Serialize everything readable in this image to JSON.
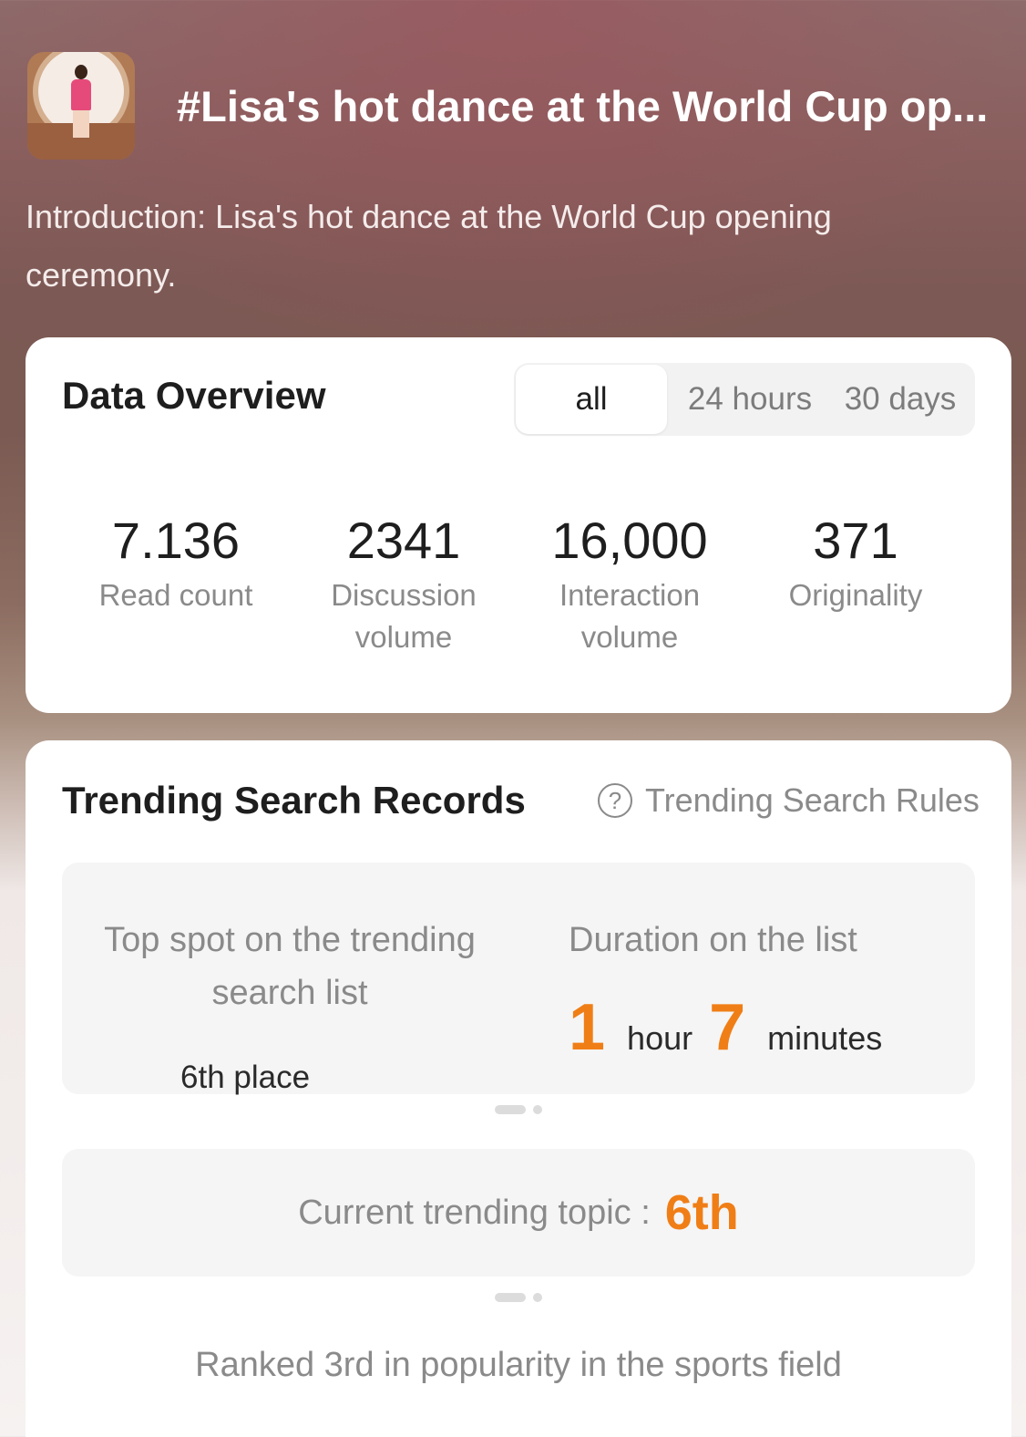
{
  "topic": {
    "title": "#Lisa's hot dance at the World Cup op...",
    "introduction": "Introduction: Lisa's hot dance at the World Cup opening ceremony."
  },
  "overview": {
    "title": "Data Overview",
    "tabs": [
      "all",
      "24 hours",
      "30 days"
    ],
    "active_tab": "all",
    "stats": [
      {
        "value": "7.136",
        "label": "Read count"
      },
      {
        "value": "2341",
        "label": "Discussion volume"
      },
      {
        "value": "16,000",
        "label": "Interaction volume"
      },
      {
        "value": "371",
        "label": "Originality"
      }
    ]
  },
  "trending": {
    "title": "Trending Search Records",
    "rules_label": "Trending Search Rules",
    "top_spot_label": "Top spot on the trending search list",
    "top_spot_value": "6th place",
    "duration_label": "Duration on the list",
    "duration_hours": "1",
    "hour_unit": "hour",
    "duration_minutes": "7",
    "minute_unit": "minutes",
    "current_label": "Current trending topic :",
    "current_value": "6th",
    "rank_text": "Ranked 3rd in popularity in the sports field"
  },
  "colors": {
    "accent": "#f07e16",
    "muted_text": "#8a8a8a",
    "card_bg": "#ffffff",
    "panel_bg": "#f5f5f5"
  },
  "icons": {
    "rules_icon": "question-circle-icon"
  }
}
